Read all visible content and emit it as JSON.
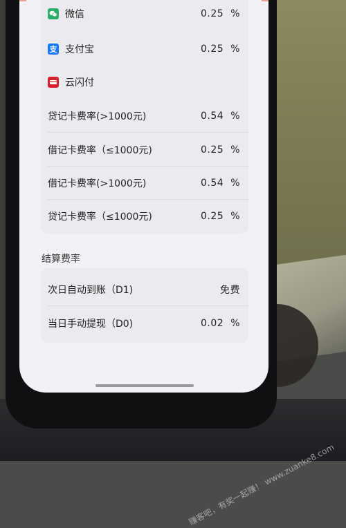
{
  "payment_channels": [
    {
      "label": "微信",
      "value": "0.25",
      "unit": "%",
      "icon": "wechat-icon"
    },
    {
      "label": "支付宝",
      "value": "0.25",
      "unit": "%",
      "icon": "alipay-icon"
    },
    {
      "label": "云闪付",
      "icon": "unionpay-icon"
    }
  ],
  "unionpay_rates": [
    {
      "label": "贷记卡费率(>1000元)",
      "value": "0.54",
      "unit": "%"
    },
    {
      "label": "借记卡费率（≤1000元)",
      "value": "0.25",
      "unit": "%"
    },
    {
      "label": "借记卡费率(>1000元)",
      "value": "0.54",
      "unit": "%"
    },
    {
      "label": "贷记卡费率（≤1000元)",
      "value": "0.25",
      "unit": "%"
    }
  ],
  "settlement": {
    "title": "结算费率",
    "rows": [
      {
        "label": "次日自动到账（D1)",
        "value": "免费"
      },
      {
        "label": "当日手动提现（D0)",
        "value": "0.02",
        "unit": "%"
      }
    ]
  },
  "watermark": "赚客吧，有奖一起赚！ www.zuanke8.com",
  "colors": {
    "wechat": "#2aae67",
    "alipay": "#1677ff",
    "unionpay": "#d8202c",
    "card": "#ebeaee",
    "screen": "#f2f1f5"
  }
}
